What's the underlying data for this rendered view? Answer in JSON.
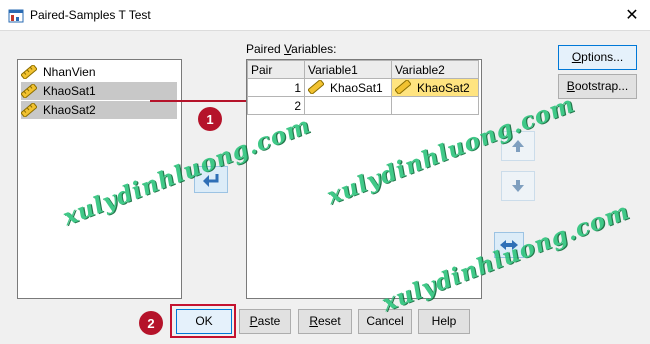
{
  "window": {
    "title": "Paired-Samples T Test",
    "close_glyph": "✕"
  },
  "variables": [
    {
      "name": "NhanVien",
      "selected": false
    },
    {
      "name": "KhaoSat1",
      "selected": true
    },
    {
      "name": "KhaoSat2",
      "selected": true
    }
  ],
  "paired": {
    "label_before": "Paired ",
    "label_hot": "V",
    "label_after": "ariables:",
    "headers": [
      "Pair",
      "Variable1",
      "Variable2"
    ],
    "rows": [
      {
        "pair": "1",
        "var1": "KhaoSat1",
        "var2": "KhaoSat2"
      },
      {
        "pair": "2",
        "var1": "",
        "var2": ""
      }
    ]
  },
  "side_buttons": {
    "options_hot": "O",
    "options_rest": "ptions...",
    "bootstrap_hot": "B",
    "bootstrap_rest": "ootstrap..."
  },
  "bottom_buttons": {
    "ok": "OK",
    "paste_hot": "P",
    "paste_rest": "aste",
    "reset_hot": "R",
    "reset_rest": "eset",
    "cancel": "Cancel",
    "help": "Help"
  },
  "badges": {
    "one": "1",
    "two": "2"
  },
  "watermark": "xulydinhluong.com",
  "colors": {
    "badge": "#b5132a",
    "watermark": "#2cc47c",
    "selection": "#ffe480"
  },
  "icons": [
    "paired-t-test-icon",
    "close-icon",
    "scale-variable-icon",
    "move-arrow-icon",
    "up-arrow-icon",
    "down-arrow-icon",
    "swap-icon"
  ]
}
